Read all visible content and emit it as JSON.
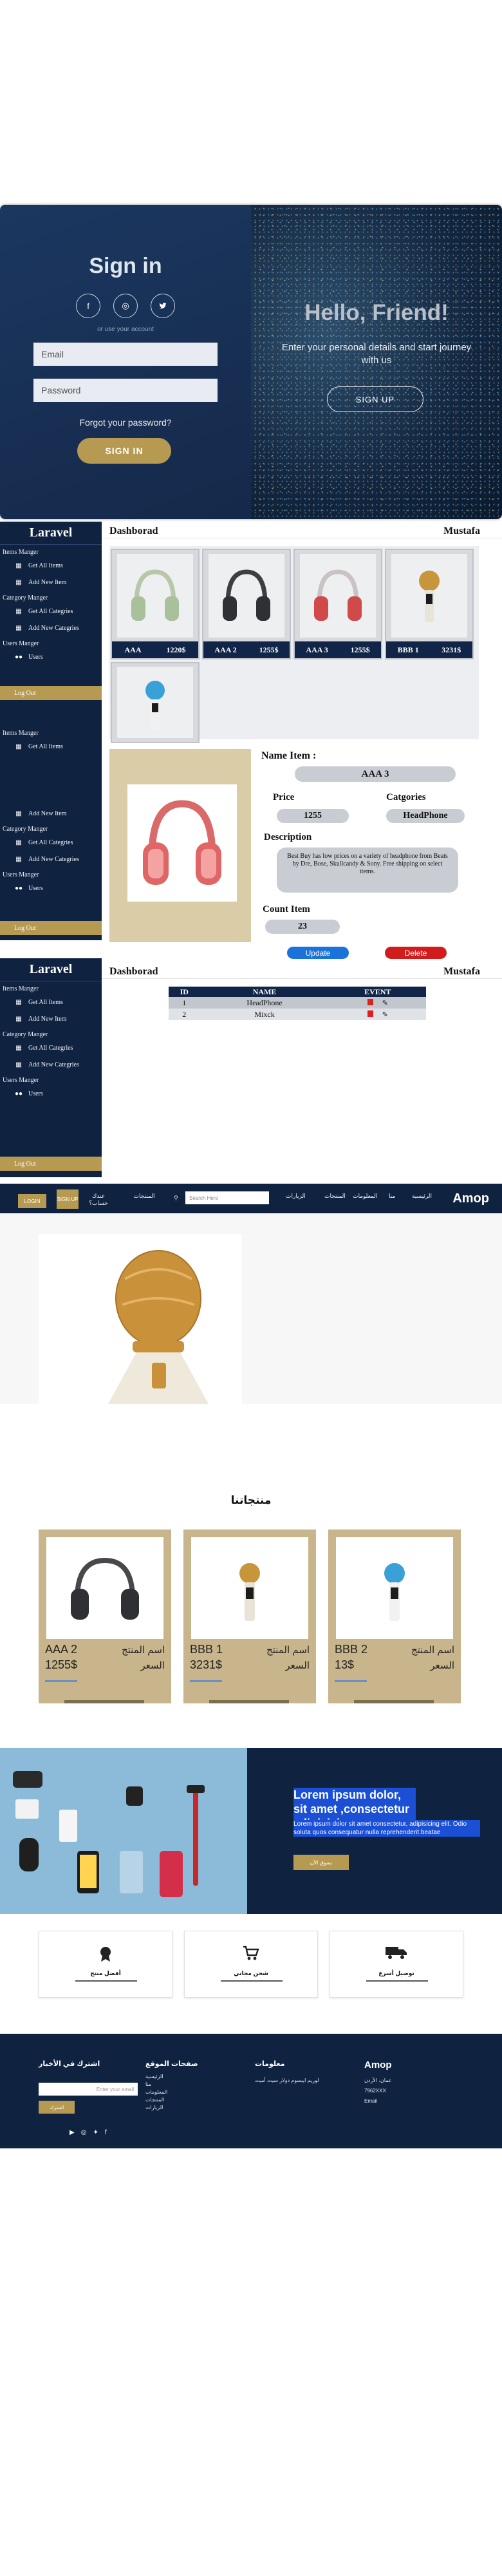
{
  "auth": {
    "title": "Sign in",
    "social": [
      "f",
      "◎",
      "t"
    ],
    "subtitle": "or use your account",
    "email_placeholder": "Email",
    "password_placeholder": "Password",
    "forgot": "Forgot your password?",
    "signin": "SIGN IN",
    "right_title": "Hello, Friend!",
    "right_text": "Enter your personal details and start journey with us",
    "signup": "SIGN UP"
  },
  "admin": {
    "brand": "Laravel",
    "groups": [
      {
        "title": "Items Manger",
        "items": [
          "Get All Items",
          "Add New Item"
        ]
      },
      {
        "title": "Category Manger",
        "items": [
          "Get All Categries",
          "Add New Categries"
        ]
      },
      {
        "title": "Users Manger",
        "items": [
          "Users"
        ]
      }
    ],
    "logout": "Log Out",
    "header_left": "Dashborad",
    "header_right": "Mustafa",
    "cards": [
      {
        "name": "AAA",
        "price": "1220$"
      },
      {
        "name": "AAA 2",
        "price": "1255$"
      },
      {
        "name": "AAA 3",
        "price": "1255$"
      },
      {
        "name": "BBB 1",
        "price": "3231$"
      }
    ],
    "detail": {
      "name_label": "Name Item :",
      "name": "AAA 3",
      "price_label": "Price",
      "price": "1255",
      "cat_label": "Catgories",
      "category": "HeadPhone",
      "desc_label": "Description",
      "description": "Best Buy has low prices on a variety of headphone from Beats by Dre, Bose, Skullcandy & Sony. Free shipping on select items.",
      "count_label": "Count Item",
      "count": "23"
    },
    "update": "Update",
    "delete": "Delete",
    "table": {
      "headers": [
        "ID",
        "NAME",
        "EVENT"
      ],
      "rows": [
        [
          "1",
          "HeadPhone"
        ],
        [
          "2",
          "Mixck"
        ]
      ]
    }
  },
  "store": {
    "brand": "Amop",
    "nav_links": [
      "الرئيسية",
      "منا",
      "المعلومات",
      "المنتجات",
      "الزيارات",
      "حسابي",
      "المنتجات",
      "الزيارات"
    ],
    "search_placeholder": "Search Here",
    "signup": "SIGN UP",
    "login": "LOGIN",
    "account_text": "عندك حساب؟",
    "products_title": "منتجاتنا",
    "products": [
      {
        "name": "AAA 2",
        "price": "1255$",
        "label1": "اسم المنتج",
        "label2": "السعر"
      },
      {
        "name": "BBB 1",
        "price": "3231$",
        "label1": "اسم المنتج",
        "label2": "السعر"
      },
      {
        "name": "BBB 2",
        "price": "13$",
        "label1": "اسم المنتج",
        "label2": "السعر"
      }
    ],
    "banner_title": "Lorem ipsum dolor, sit amet ,consectetur adipisicing",
    "banner_text": "Lorem ipsum dolor sit amet consectetur, adipisicing elit. Odio soluta quos consequatur nulla reprehenderit beatae",
    "banner_btn": "تسوق الآن",
    "features": [
      "أفضل منتج",
      "شحن مجاني",
      "توصيل أسرع"
    ],
    "footer": {
      "brand": "Amop",
      "info_title": "معلومات",
      "info_text": "لوريم ايبسوم دولار سيت أميت",
      "contact": [
        "عمان، الأردن",
        "7962XXX",
        "Email"
      ],
      "pages_title": "صفحات الموقع",
      "pages": [
        "الرئيسية",
        "منا",
        "المعلومات",
        "المنتجات",
        "الزيارات"
      ],
      "news_title": "اشترك في الأخبار",
      "email_placeholder": "Enter your email",
      "subscribe": "اشترك",
      "socials": [
        "yt",
        "ig",
        "tw",
        "fb"
      ]
    }
  }
}
